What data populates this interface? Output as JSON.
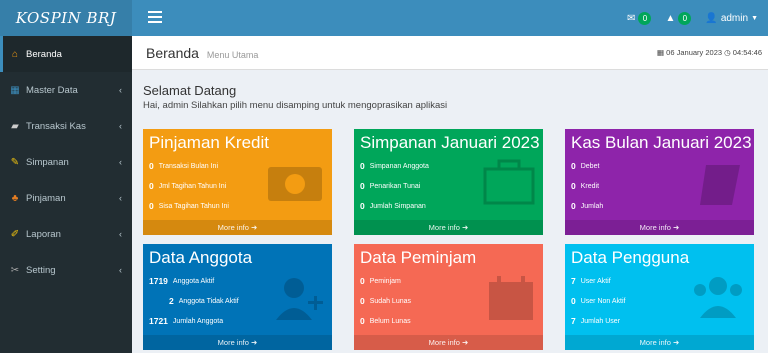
{
  "app": {
    "logo": "KOSPIN BRJ"
  },
  "topbar": {
    "mail_count": "0",
    "alert_count": "0",
    "user": "admin"
  },
  "sidebar": {
    "items": [
      {
        "label": "Beranda",
        "icon": "home-icon"
      },
      {
        "label": "Master Data",
        "icon": "database-icon"
      },
      {
        "label": "Transaksi Kas",
        "icon": "cash-icon"
      },
      {
        "label": "Simpanan",
        "icon": "savings-icon"
      },
      {
        "label": "Pinjaman",
        "icon": "people-icon"
      },
      {
        "label": "Laporan",
        "icon": "report-icon"
      },
      {
        "label": "Setting",
        "icon": "wrench-icon"
      }
    ]
  },
  "header": {
    "title": "Beranda",
    "subtitle": "Menu Utama",
    "date": "06 January 2023",
    "time": "04:54:46"
  },
  "welcome": {
    "title": "Selamat Datang",
    "text": "Hai, admin Silahkan pilih menu disamping untuk mengoprasikan aplikasi"
  },
  "boxes": [
    {
      "title": "Pinjaman Kredit",
      "color": "#f39c12",
      "icon": "money-icon",
      "more": "More info",
      "rows": [
        {
          "num": "0",
          "label": "Transaksi Bulan Ini"
        },
        {
          "num": "0",
          "label": "Jml Tagihan Tahun Ini"
        },
        {
          "num": "0",
          "label": "Sisa Tagihan Tahun Ini"
        }
      ]
    },
    {
      "title": "Simpanan Januari 2023",
      "color": "#00a65a",
      "icon": "briefcase-icon",
      "more": "More info",
      "rows": [
        {
          "num": "0",
          "label": "Simpanan Anggota"
        },
        {
          "num": "0",
          "label": "Penarikan Tunai"
        },
        {
          "num": "0",
          "label": "Jumlah Simpanan"
        }
      ]
    },
    {
      "title": "Kas Bulan Januari 2023",
      "color": "#8e24aa",
      "icon": "book-icon",
      "more": "More info",
      "rows": [
        {
          "num": "0",
          "label": "Debet"
        },
        {
          "num": "0",
          "label": "Kredit"
        },
        {
          "num": "0",
          "label": "Jumlah"
        }
      ]
    },
    {
      "title": "Data Anggota",
      "color": "#0073b7",
      "icon": "user-add-icon",
      "more": "More info",
      "rows": [
        {
          "num": "1719",
          "label": "Anggota Aktif"
        },
        {
          "num": "2",
          "label": "Anggota Tidak Aktif"
        },
        {
          "num": "1721",
          "label": "Jumlah Anggota"
        }
      ]
    },
    {
      "title": "Data Peminjam",
      "color": "#f56954",
      "icon": "calendar-icon",
      "more": "More info",
      "rows": [
        {
          "num": "0",
          "label": "Peminjam"
        },
        {
          "num": "0",
          "label": "Sudah Lunas"
        },
        {
          "num": "0",
          "label": "Belum Lunas"
        }
      ]
    },
    {
      "title": "Data Pengguna",
      "color": "#00c0ef",
      "icon": "users-icon",
      "more": "More info",
      "rows": [
        {
          "num": "7",
          "label": "User Aktif"
        },
        {
          "num": "0",
          "label": "User Non Aktif"
        },
        {
          "num": "7",
          "label": "Jumlah User"
        }
      ]
    }
  ]
}
